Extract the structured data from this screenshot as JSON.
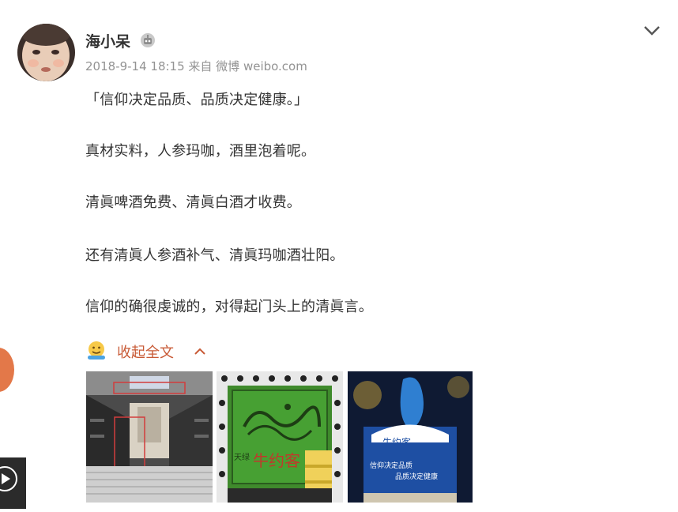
{
  "post": {
    "username": "海小呆",
    "date": "2018-9-14 18:15",
    "source": "来自 微博 weibo.com",
    "paragraphs": [
      "「信仰决定品质、品质决定健康。」",
      "真材实料，人参玛咖，酒里泡着呢。",
      "清眞啤酒免费、清眞白酒才收费。",
      "还有清眞人参酒补气、清眞玛咖酒壮阳。",
      "信仰的确很虔诚的，对得起门头上的清眞言。"
    ],
    "collapse_label": "收起全文"
  },
  "images": [
    {
      "name": "stairway-photo",
      "alt": ""
    },
    {
      "name": "green-sign-photo",
      "alt": ""
    },
    {
      "name": "blue-poster-photo",
      "alt": ""
    }
  ],
  "image_text": {
    "sign_left": "天绿",
    "sign_brand": "牛约客",
    "poster_brand": "牛约客",
    "poster_line1": "信仰决定品质",
    "poster_line2": "品质决定健康"
  },
  "icons": {
    "badge": "robot-badge-icon",
    "menu": "chevron-down-icon",
    "emoji": "hug-emoji-icon",
    "collapse": "chevron-up-icon",
    "play": "play-icon"
  },
  "colors": {
    "link": "#c85a36",
    "meta": "#939393",
    "text": "#333333"
  }
}
